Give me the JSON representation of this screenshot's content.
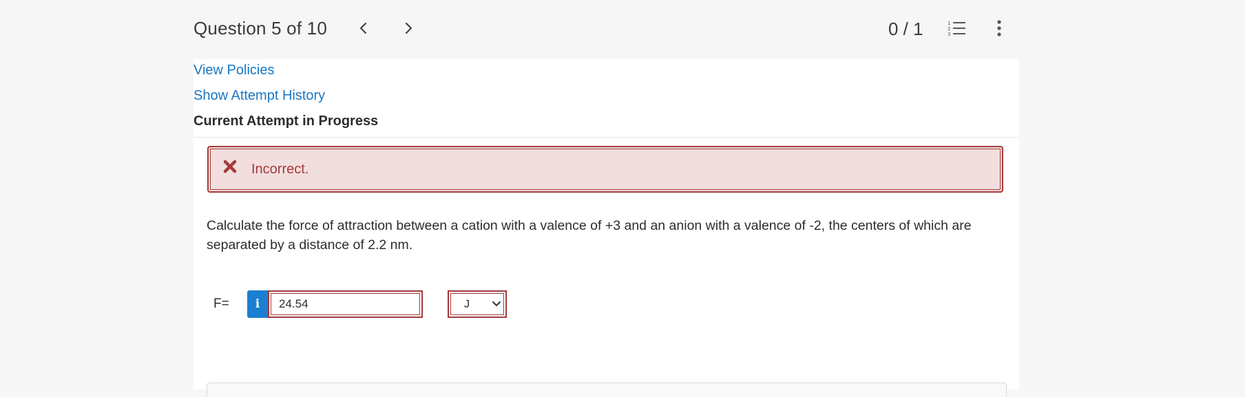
{
  "header": {
    "question_counter": "Question 5 of 10",
    "score": "0 / 1",
    "prev_icon": "chevron-left-icon",
    "next_icon": "chevron-right-icon",
    "list_icon": "numbered-list-icon",
    "more_icon": "vertical-ellipsis-icon"
  },
  "links": {
    "view_policies": "View Policies",
    "show_attempt_history": "Show Attempt History"
  },
  "attempt": {
    "heading": "Current Attempt in Progress"
  },
  "feedback": {
    "icon": "x-mark-icon",
    "text": "Incorrect."
  },
  "question": {
    "text": "Calculate the force of attraction between a cation with a valence of +3 and an anion with a valence of -2, the centers of which are separated by a distance of 2.2 nm."
  },
  "answer": {
    "label": "F=",
    "info_icon": "info-icon",
    "value": "24.54",
    "unit_selected": "J"
  },
  "colors": {
    "link": "#1976c2",
    "error": "#a33a3a",
    "error_bg": "#f2dede",
    "info_button": "#1a7fd0"
  }
}
